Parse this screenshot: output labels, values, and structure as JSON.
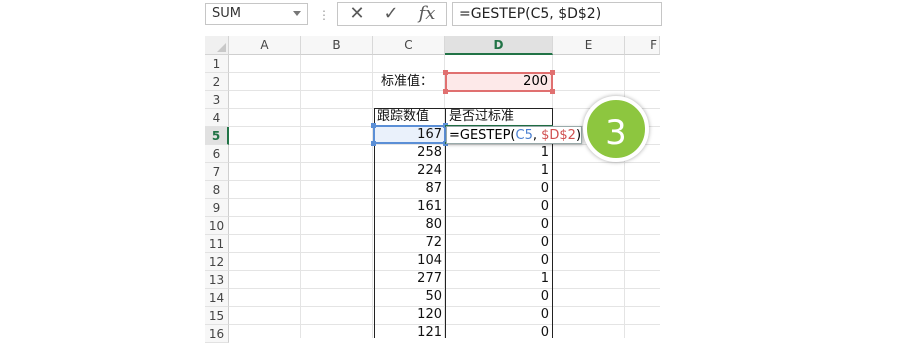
{
  "formula_bar": {
    "name_box": "SUM",
    "separator": "⋮",
    "cancel_icon": "✕",
    "enter_icon": "✓",
    "fx_label": "fx",
    "formula": "=GESTEP(C5, $D$2)"
  },
  "columns": [
    "A",
    "B",
    "C",
    "D",
    "E",
    "F"
  ],
  "selected_column": "D",
  "rows": [
    "1",
    "2",
    "3",
    "4",
    "5",
    "6",
    "7",
    "8",
    "9",
    "10",
    "11",
    "12",
    "13",
    "14",
    "15",
    "16"
  ],
  "selected_row": "5",
  "label_d2": "标准值：",
  "threshold": "200",
  "table": {
    "headers": [
      "跟踪数值",
      "是否过标准"
    ],
    "values": [
      "167",
      "258",
      "224",
      "87",
      "161",
      "80",
      "72",
      "104",
      "277",
      "50",
      "120",
      "121"
    ],
    "results": [
      "",
      "1",
      "1",
      "0",
      "0",
      "0",
      "0",
      "0",
      "1",
      "0",
      "0",
      "0"
    ]
  },
  "edit_formula": {
    "prefix": "=GESTEP(",
    "ref1": "C5",
    "sep": ", ",
    "ref2": "$D$2",
    "suffix": ")"
  },
  "step_number": "3",
  "colors": {
    "accent_green": "#217346",
    "badge_green": "#8dc63f",
    "ref_blue": "#4a7fd0",
    "ref_red": "#d05050"
  }
}
